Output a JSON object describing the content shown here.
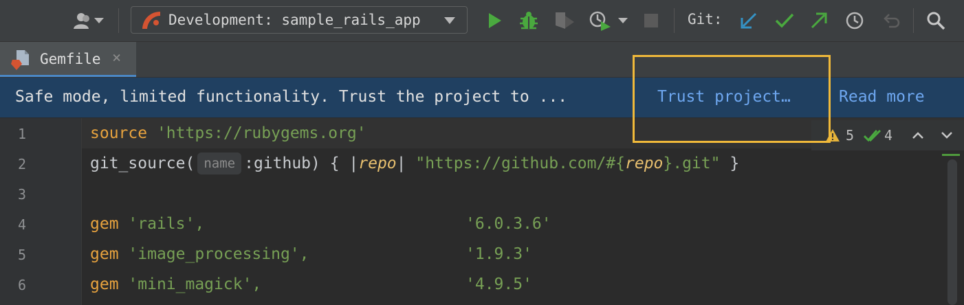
{
  "toolbar": {
    "run_config": "Development: sample_rails_app",
    "git_label": "Git:"
  },
  "tab": {
    "label": "Gemfile",
    "close": "×"
  },
  "banner": {
    "message": "Safe mode, limited functionality. Trust the project to ...",
    "trust_link": "Trust project…",
    "read_more_link": "Read more"
  },
  "inspections": {
    "warnings": "5",
    "weak_warnings": "4"
  },
  "editor": {
    "line_numbers": [
      "1",
      "2",
      "3",
      "4",
      "5",
      "6"
    ],
    "line1": {
      "keyword": "source",
      "string": "'https://rubygems.org'"
    },
    "line2": {
      "call": "git_source(",
      "hint": "name",
      "arg": ":github) { |",
      "param": "repo",
      "pipe": "| ",
      "str_start": "\"https://github.com/#{",
      "param2": "repo",
      "str_end": "}.git\"",
      "close": " }"
    },
    "gems": [
      {
        "kw": "gem",
        "name": "'rails',",
        "version": "'6.0.3.6'"
      },
      {
        "kw": "gem",
        "name": "'image_processing',",
        "version": "'1.9.3'"
      },
      {
        "kw": "gem",
        "name": "'mini_magick',",
        "version": "'4.9.5'"
      }
    ]
  },
  "colors": {
    "accent_highlight": "#f0b93a",
    "banner_bg": "#204061",
    "link": "#6ea7f0"
  }
}
